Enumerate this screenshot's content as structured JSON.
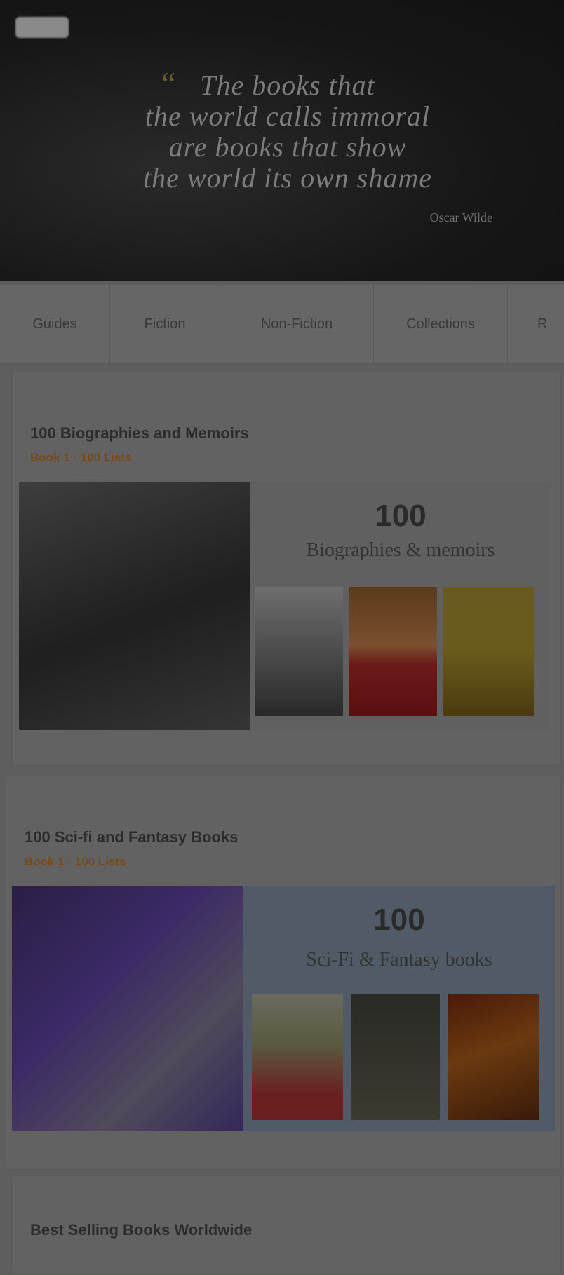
{
  "hero": {
    "logo_name": "site-logo",
    "quote_lines": [
      "The books that",
      "the world calls immoral",
      "are books that show",
      "the world its own shame"
    ],
    "attribution": "Oscar Wilde"
  },
  "tabs": [
    {
      "label": "Guides"
    },
    {
      "label": "Fiction"
    },
    {
      "label": "Non-Fiction"
    },
    {
      "label": "Collections"
    },
    {
      "label": "R"
    }
  ],
  "cards": [
    {
      "title": "100 Biographies and Memoirs",
      "meta": "Book 1 · 100 Lists",
      "banner": {
        "number": "100",
        "label": "Biographies & memoirs"
      }
    },
    {
      "title": "100 Sci-fi and Fantasy Books",
      "meta": "Book 1 · 100 Lists",
      "banner": {
        "number": "100",
        "label": "Sci-Fi & Fantasy books"
      }
    },
    {
      "title": "Best Selling Books Worldwide",
      "meta": "",
      "banner": null
    }
  ],
  "colors": {
    "overlay_background": "#5e5e5e",
    "hero_background": "#161616",
    "accent_meta": "#7a4a1a"
  }
}
